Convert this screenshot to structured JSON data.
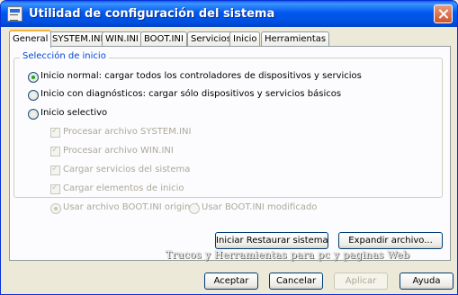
{
  "window": {
    "title": "Utilidad de configuración del sistema",
    "icons": {
      "app": "msconfig-icon",
      "close": "close-icon"
    }
  },
  "tabs": [
    {
      "label": "General",
      "active": true
    },
    {
      "label": "SYSTEM.INI",
      "active": false
    },
    {
      "label": "WIN.INI",
      "active": false
    },
    {
      "label": "BOOT.INI",
      "active": false
    },
    {
      "label": "Servicios",
      "active": false
    },
    {
      "label": "Inicio",
      "active": false
    },
    {
      "label": "Herramientas",
      "active": false
    }
  ],
  "group": {
    "label": "Selección de inicio",
    "options": [
      {
        "label": "Inicio normal: cargar todos los controladores de dispositivos y servicios",
        "checked": true
      },
      {
        "label": "Inicio con diagnósticos: cargar sólo dispositivos y servicios básicos",
        "checked": false
      },
      {
        "label": "Inicio selectivo",
        "checked": false
      }
    ],
    "selective": [
      {
        "label": "Procesar archivo SYSTEM.INI",
        "checked": true,
        "enabled": false
      },
      {
        "label": "Procesar archivo WIN.INI",
        "checked": true,
        "enabled": false
      },
      {
        "label": "Cargar servicios del sistema",
        "checked": true,
        "enabled": false
      },
      {
        "label": "Cargar elementos de inicio",
        "checked": true,
        "enabled": false
      }
    ],
    "boot": [
      {
        "label": "Usar archivo BOOT.INI original",
        "checked": true,
        "enabled": false
      },
      {
        "label": "Usar BOOT.INI modificado",
        "checked": false,
        "enabled": false
      }
    ]
  },
  "actions": {
    "restore": "Iniciar Restaurar sistema",
    "expand": "Expandir archivo..."
  },
  "watermark": "Trucos y Herramientas para pc y paginas Web",
  "footer": {
    "accept": "Aceptar",
    "cancel": "Cancelar",
    "apply": "Aplicar",
    "help": "Ayuda"
  },
  "colors": {
    "titlebar": "#0054e3",
    "group_label": "#0046d5",
    "active_tab_top": "#f7b33f"
  }
}
